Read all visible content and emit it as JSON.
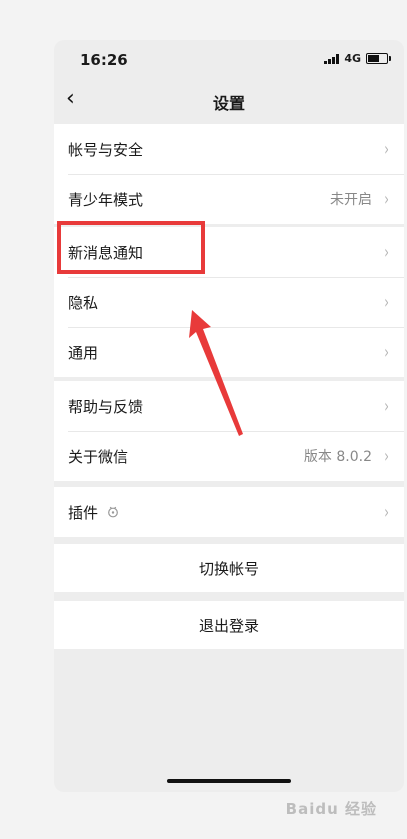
{
  "status_bar": {
    "time": "16:26",
    "network": "4G",
    "battery_level": 0.6
  },
  "nav": {
    "back_icon": "‹",
    "title": "设置"
  },
  "groups": [
    {
      "items": [
        {
          "label": "帐号与安全",
          "value": ""
        },
        {
          "label": "青少年模式",
          "value": "未开启"
        }
      ]
    },
    {
      "items": [
        {
          "label": "新消息通知",
          "value": ""
        },
        {
          "label": "隐私",
          "value": ""
        },
        {
          "label": "通用",
          "value": ""
        }
      ]
    },
    {
      "items": [
        {
          "label": "帮助与反馈",
          "value": ""
        },
        {
          "label": "关于微信",
          "value": "版本 8.0.2"
        }
      ]
    },
    {
      "items": [
        {
          "label": "插件",
          "value": ""
        }
      ]
    }
  ],
  "buttons": {
    "switch_account": "切换帐号",
    "logout": "退出登录"
  },
  "chevron": "›",
  "annotation": {
    "color": "#e83a3a",
    "target": "新消息通知"
  },
  "watermark": "Baidu 经验"
}
